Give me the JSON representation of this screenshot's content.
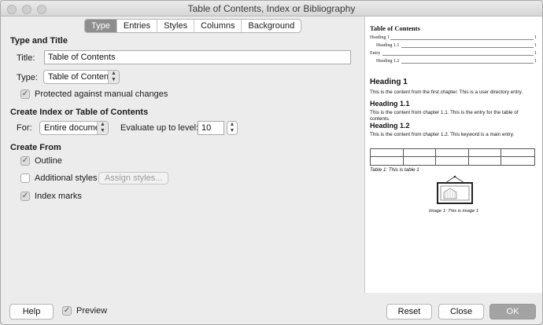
{
  "window": {
    "title": "Table of Contents, Index or Bibliography"
  },
  "tabs": [
    {
      "label": "Type",
      "active": true
    },
    {
      "label": "Entries"
    },
    {
      "label": "Styles"
    },
    {
      "label": "Columns"
    },
    {
      "label": "Background"
    }
  ],
  "type_and_title": {
    "heading": "Type and Title",
    "title_label": "Title:",
    "title_value": "Table of Contents",
    "type_label": "Type:",
    "type_value": "Table of Contents",
    "protected_label": "Protected against manual changes",
    "protected_checked": true
  },
  "create_index": {
    "heading": "Create Index or Table of Contents",
    "for_label": "For:",
    "for_value": "Entire document",
    "evaluate_label": "Evaluate up to level:",
    "evaluate_value": "10"
  },
  "create_from": {
    "heading": "Create From",
    "outline_label": "Outline",
    "outline_checked": true,
    "additional_label": "Additional styles",
    "additional_checked": false,
    "assign_styles_label": "Assign styles...",
    "index_marks_label": "Index marks",
    "index_marks_checked": true
  },
  "preview": {
    "toc_title": "Table of Contents",
    "toc_entries": [
      {
        "text": "Heading 1",
        "page": "1"
      },
      {
        "text": "Heading 1.1",
        "page": "1"
      },
      {
        "text": "Entry",
        "page": "1"
      },
      {
        "text": "Heading 1.2",
        "page": "1"
      }
    ],
    "h1": "Heading 1",
    "p1": "This is the content from the first chapter. This is a user directory entry.",
    "h11": "Heading 1.1",
    "p11": "This is the content from chapter 1.1. This is the entry for the table of contents.",
    "h12": "Heading 1.2",
    "p12": "This is the content from chapter 1.2. This keyword is a main entry.",
    "table_caption": "Table 1: This is table 1",
    "image_caption": "Image 1: This is image 1"
  },
  "footer": {
    "help_label": "Help",
    "preview_label": "Preview",
    "preview_checked": true,
    "reset_label": "Reset",
    "close_label": "Close",
    "ok_label": "OK"
  }
}
